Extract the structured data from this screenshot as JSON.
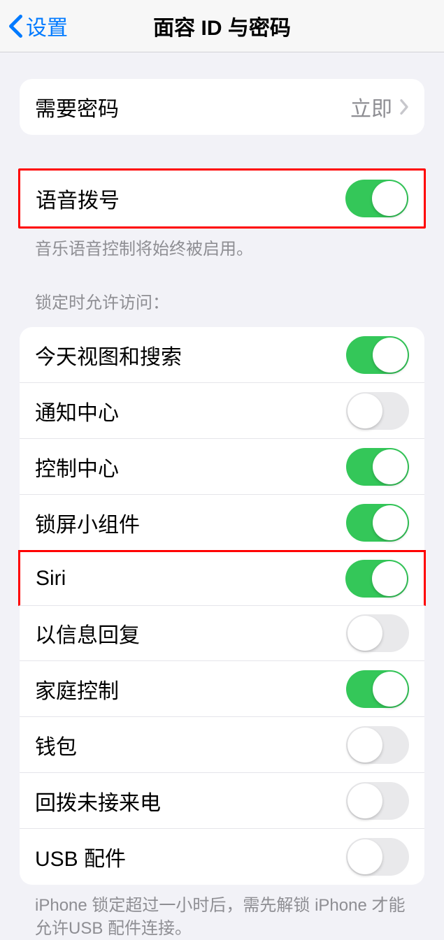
{
  "header": {
    "back_label": "设置",
    "title": "面容 ID 与密码"
  },
  "passcode_group": {
    "require_passcode": {
      "label": "需要密码",
      "value": "立即"
    }
  },
  "voice_dial": {
    "label": "语音拨号",
    "enabled": true,
    "footer": "音乐语音控制将始终被启用。"
  },
  "lock_access": {
    "header": "锁定时允许访问：",
    "items": [
      {
        "label": "今天视图和搜索",
        "enabled": true
      },
      {
        "label": "通知中心",
        "enabled": false
      },
      {
        "label": "控制中心",
        "enabled": true
      },
      {
        "label": "锁屏小组件",
        "enabled": true
      },
      {
        "label": "Siri",
        "enabled": true
      },
      {
        "label": "以信息回复",
        "enabled": false
      },
      {
        "label": "家庭控制",
        "enabled": true
      },
      {
        "label": "钱包",
        "enabled": false
      },
      {
        "label": "回拨未接来电",
        "enabled": false
      },
      {
        "label": "USB 配件",
        "enabled": false
      }
    ],
    "footer": "iPhone 锁定超过一小时后，需先解锁 iPhone 才能允许USB 配件连接。"
  }
}
